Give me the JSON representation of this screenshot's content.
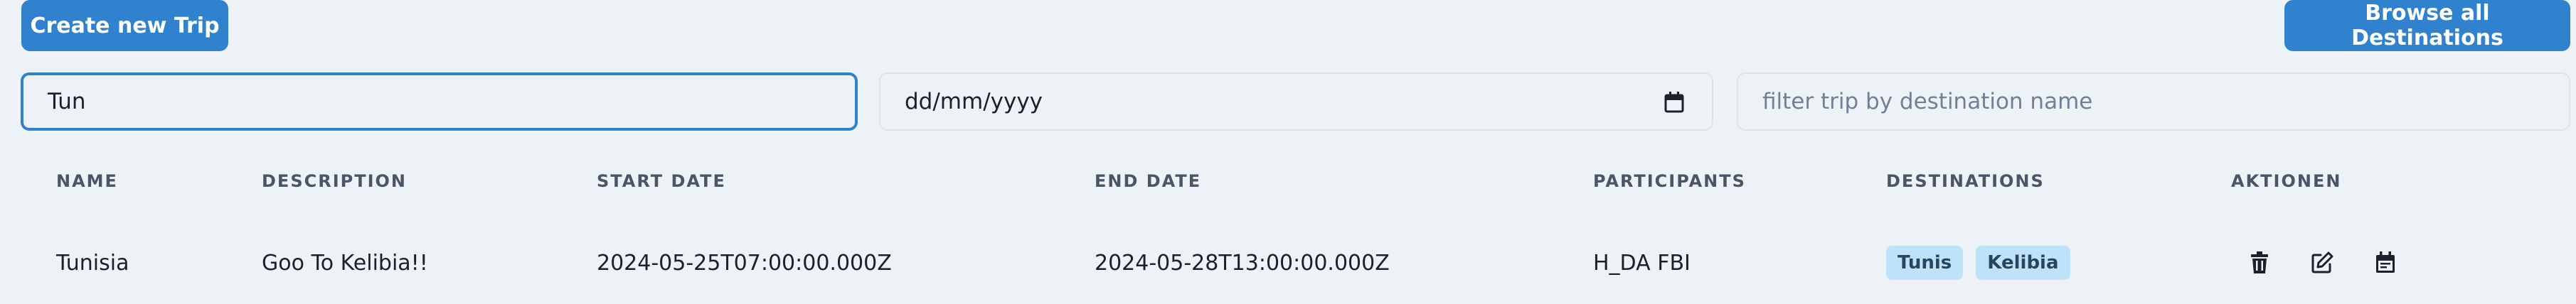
{
  "toolbar": {
    "create_label": "Create new Trip",
    "browse_label": "Browse all Destinations"
  },
  "filters": {
    "search_value": "Tun",
    "date_placeholder": "dd/mm/yyyy",
    "destination_placeholder": "filter trip by destination name"
  },
  "table": {
    "headers": [
      "NAME",
      "DESCRIPTION",
      "START DATE",
      "END DATE",
      "PARTICIPANTS",
      "DESTINATIONS",
      "AKTIONEN"
    ],
    "rows": [
      {
        "name": "Tunisia",
        "description": "Goo To Kelibia!!",
        "start_date": "2024-05-25T07:00:00.000Z",
        "end_date": "2024-05-28T13:00:00.000Z",
        "participants": "H_DA FBI",
        "destinations": [
          "Tunis",
          "Kelibia"
        ],
        "actions": [
          "trash-icon",
          "edit-icon",
          "calendar-icon"
        ]
      }
    ]
  },
  "colors": {
    "accent": "#3182ce",
    "background": "#edf2f7",
    "tag_background": "#bee3f8",
    "tag_text": "#2a4365"
  }
}
